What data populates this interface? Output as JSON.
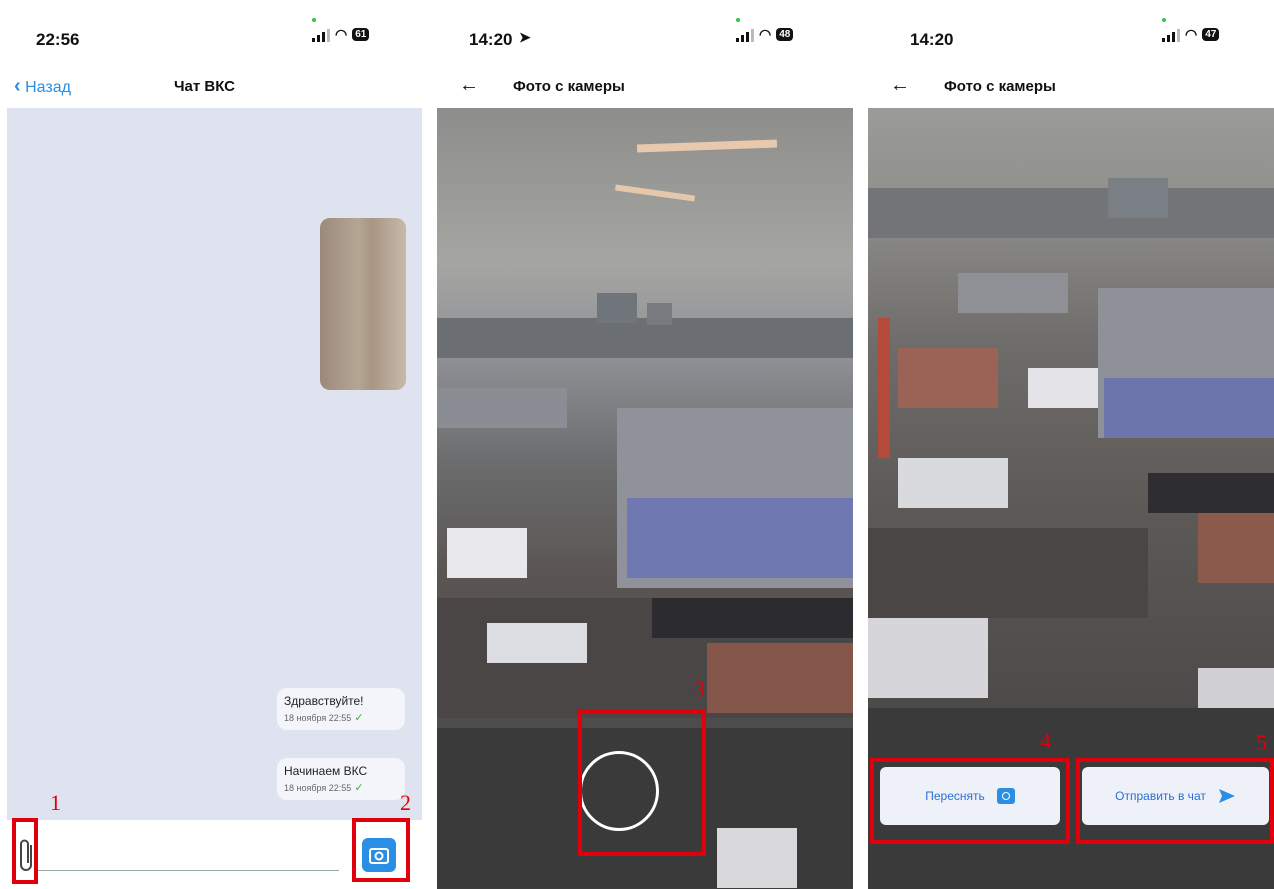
{
  "screens": [
    {
      "status": {
        "time": "22:56",
        "battery": "61"
      },
      "nav": {
        "back_label": "Назад",
        "title": "Чат ВКС"
      },
      "messages": [
        {
          "text": "Здравствуйте!",
          "time": "18 ноября 22:55"
        },
        {
          "text": "Начинаем ВКС",
          "time": "18 ноября 22:55"
        }
      ]
    },
    {
      "status": {
        "time": "14:20",
        "battery": "48"
      },
      "nav": {
        "title": "Фото с камеры"
      }
    },
    {
      "status": {
        "time": "14:20",
        "battery": "47"
      },
      "nav": {
        "title": "Фото с камеры"
      },
      "actions": {
        "retake_label": "Переснять",
        "send_label": "Отправить в чат"
      }
    }
  ],
  "annotations": [
    "1",
    "2",
    "3",
    "4",
    "5"
  ],
  "colors": {
    "accent": "#2b8ee5",
    "annotation": "#e0000c",
    "chat_bg": "#dfe3ef"
  }
}
